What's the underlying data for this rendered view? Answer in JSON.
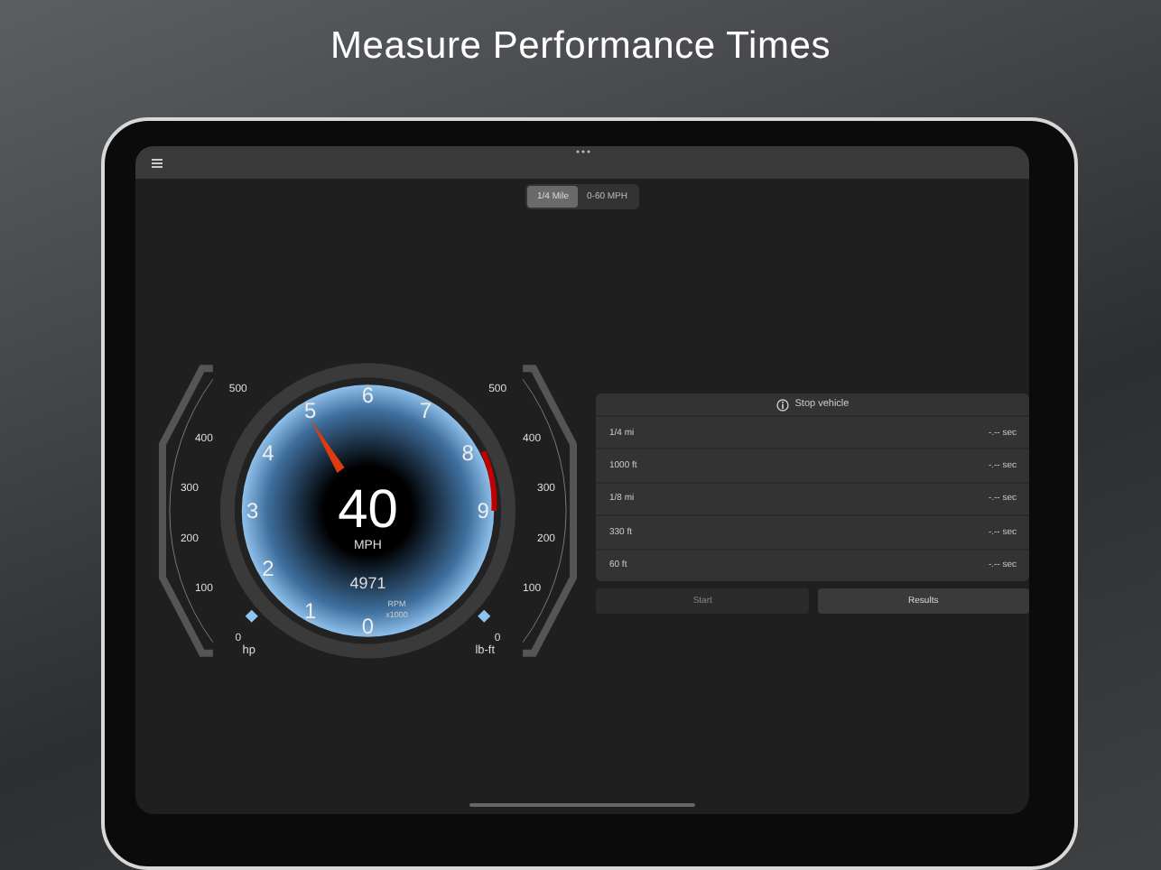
{
  "headline": "Measure Performance Times",
  "segments": [
    {
      "label": "1/4 Mile",
      "selected": true
    },
    {
      "label": "0-60 MPH",
      "selected": false
    }
  ],
  "gauge": {
    "speed": "40",
    "speed_unit": "MPH",
    "rpm": "4971",
    "rpm_label": "RPM",
    "rpm_scale": "x1000",
    "dial_labels": [
      "0",
      "1",
      "2",
      "3",
      "4",
      "5",
      "6",
      "7",
      "8",
      "9"
    ],
    "left_scale": {
      "labels": [
        "500",
        "400",
        "300",
        "200",
        "100",
        "0"
      ],
      "unit": "hp"
    },
    "right_scale": {
      "labels": [
        "500",
        "400",
        "300",
        "200",
        "100",
        "0"
      ],
      "unit": "lb-ft"
    }
  },
  "results": {
    "status": "Stop vehicle",
    "rows": [
      {
        "distance": "1/4 mi",
        "time": "-.-- sec"
      },
      {
        "distance": "1000 ft",
        "time": "-.-- sec"
      },
      {
        "distance": "1/8 mi",
        "time": "-.-- sec"
      },
      {
        "distance": "330 ft",
        "time": "-.-- sec"
      },
      {
        "distance": "60 ft",
        "time": "-.-- sec"
      }
    ]
  },
  "buttons": [
    {
      "label": "Start",
      "disabled": true
    },
    {
      "label": "Results",
      "disabled": false
    }
  ]
}
